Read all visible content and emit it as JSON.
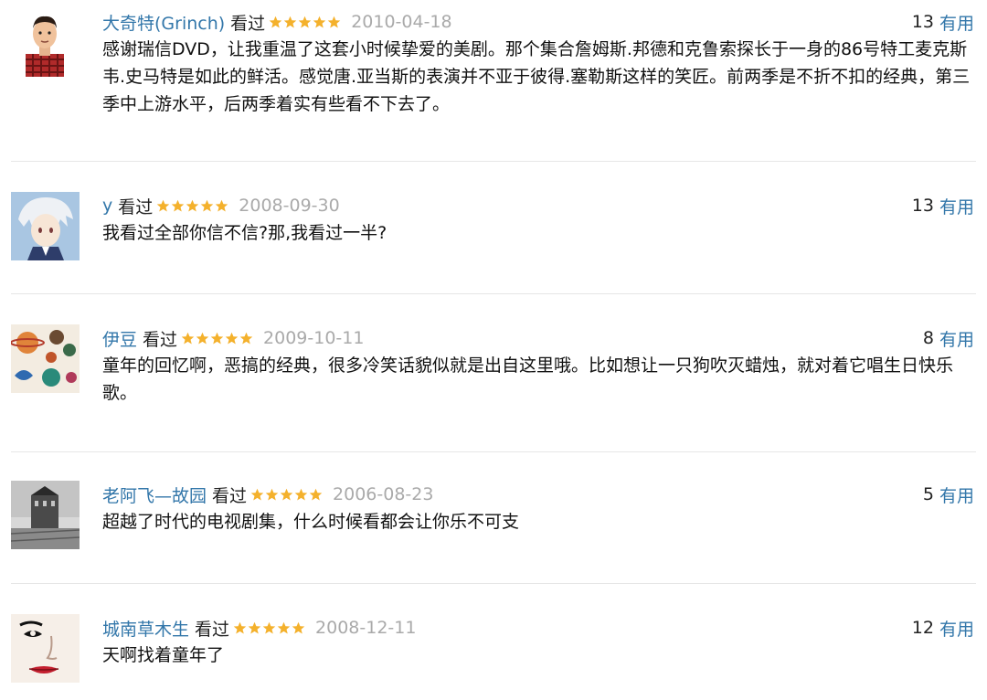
{
  "comments": [
    {
      "author": "大奇特(Grinch)",
      "status": "看过",
      "rating": 5,
      "date": "2010-04-18",
      "votes": "13",
      "useful_label": "有用",
      "avatar_icon": "man-portrait-avatar",
      "text": "感谢瑞信DVD，让我重温了这套小时候挚爱的美剧。那个集合詹姆斯.邦德和克鲁索探长于一身的86号特工麦克斯韦.史马特是如此的鲜活。感觉唐.亚当斯的表演并不亚于彼得.塞勒斯这样的笑匠。前两季是不折不扣的经典，第三季中上游水平，后两季着实有些看不下去了。"
    },
    {
      "author": "y",
      "status": "看过",
      "rating": 5,
      "date": "2008-09-30",
      "votes": "13",
      "useful_label": "有用",
      "avatar_icon": "anime-character-avatar",
      "text": "我看过全部你信不信?那,我看过一半?"
    },
    {
      "author": "伊豆",
      "status": "看过",
      "rating": 5,
      "date": "2009-10-11",
      "votes": "8",
      "useful_label": "有用",
      "avatar_icon": "planet-drawing-avatar",
      "text": "童年的回忆啊，恶搞的经典，很多冷笑话貌似就是出自这里哦。比如想让一只狗吹灭蜡烛，就对着它唱生日快乐歌。"
    },
    {
      "author": "老阿飞—故园",
      "status": "看过",
      "rating": 5,
      "date": "2006-08-23",
      "votes": "5",
      "useful_label": "有用",
      "avatar_icon": "tower-photo-avatar",
      "text": "超越了时代的电视剧集，什么时候看都会让你乐不可支"
    },
    {
      "author": "城南草木生",
      "status": "看过",
      "rating": 5,
      "date": "2008-12-11",
      "votes": "12",
      "useful_label": "有用",
      "avatar_icon": "face-sketch-avatar",
      "text": "天啊找着童年了"
    }
  ],
  "colors": {
    "link": "#3377aa",
    "star": "#f4b12c",
    "date": "#aaaaaa",
    "divider": "#e6e6e6"
  }
}
